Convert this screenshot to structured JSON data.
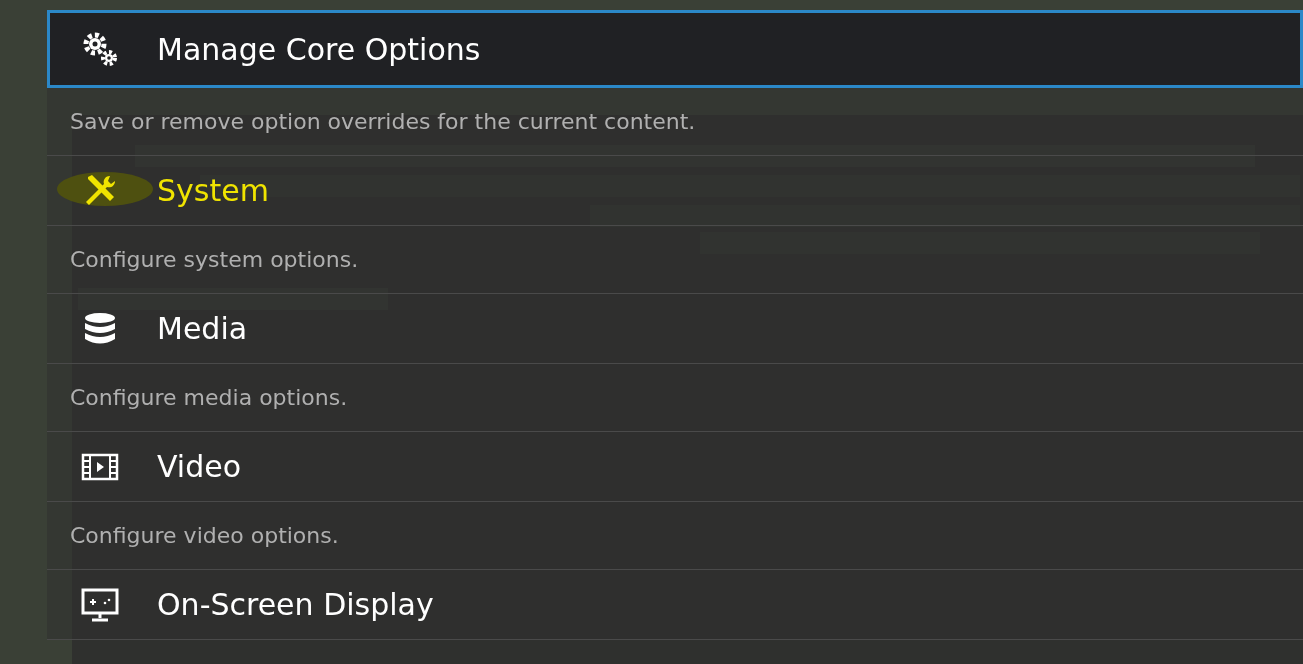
{
  "menu": {
    "items": [
      {
        "title": "Manage Core Options",
        "kind": "gears",
        "sublabel": "Save or remove option overrides for the current content.",
        "selected": true,
        "highlighted": false
      },
      {
        "title": "System",
        "kind": "tools",
        "sublabel": "Configure system options.",
        "selected": false,
        "highlighted": true
      },
      {
        "title": "Media",
        "kind": "database",
        "sublabel": "Configure media options.",
        "selected": false,
        "highlighted": false
      },
      {
        "title": "Video",
        "kind": "film",
        "sublabel": "Configure video options.",
        "selected": false,
        "highlighted": false
      },
      {
        "title": "On-Screen Display",
        "kind": "monitor",
        "selected": false,
        "highlighted": false
      }
    ]
  }
}
